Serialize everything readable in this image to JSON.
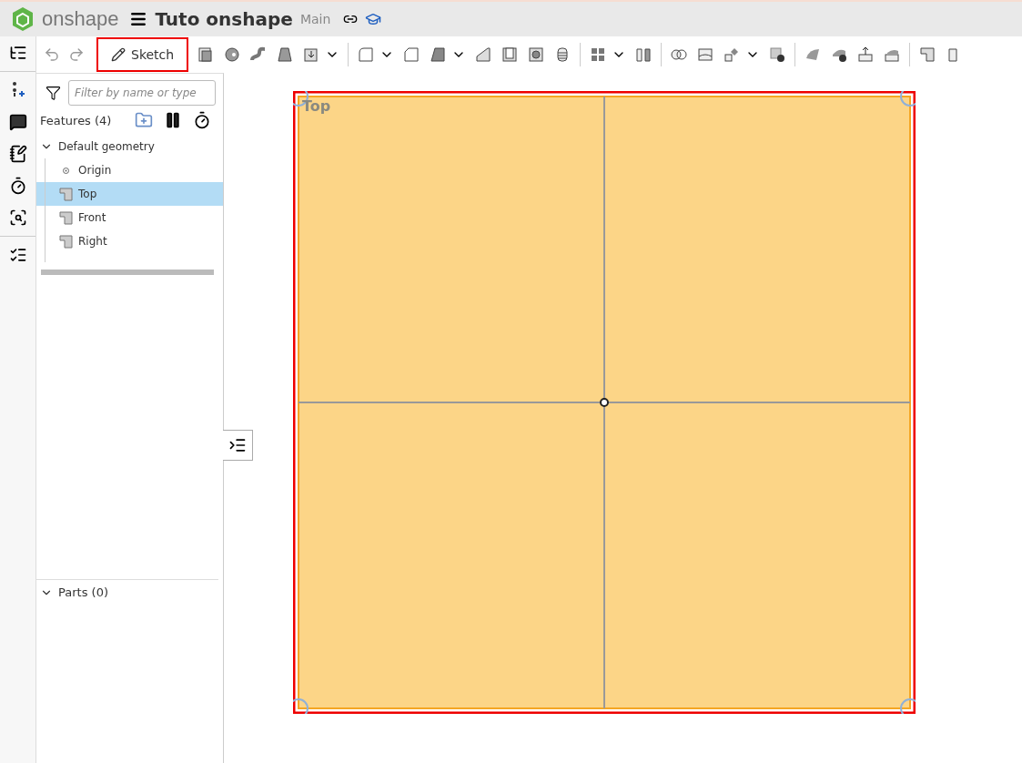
{
  "header": {
    "brand": "onshape",
    "title": "Tuto onshape",
    "branch": "Main"
  },
  "toolbar": {
    "sketch_button": {
      "label": "Sketch",
      "highlighted": true
    }
  },
  "feature_panel": {
    "filter": {
      "placeholder": "Filter by name or type"
    },
    "features_heading": "Features (4)",
    "tree": [
      {
        "label": "Default geometry",
        "selected": false,
        "expanded": true,
        "children": [
          {
            "label": "Origin",
            "kind": "point",
            "selected": false
          },
          {
            "label": "Top",
            "kind": "plane",
            "selected": true
          },
          {
            "label": "Front",
            "kind": "plane",
            "selected": false
          },
          {
            "label": "Right",
            "kind": "plane",
            "selected": false
          }
        ]
      }
    ],
    "parts": {
      "label": "Parts (0)",
      "expanded": true
    }
  },
  "viewport": {
    "plane": {
      "label": "Top",
      "highlighted": true
    }
  }
}
